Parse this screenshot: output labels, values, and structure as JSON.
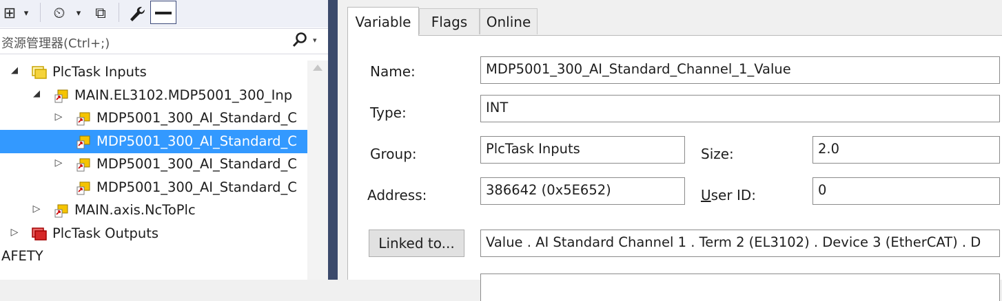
{
  "toolbar": {
    "items": [
      {
        "name": "add-item-icon",
        "glyph": "⊞"
      },
      {
        "name": "dropdown-caret-icon",
        "glyph": "▾"
      },
      {
        "name": "history-icon",
        "glyph": "⏲"
      },
      {
        "name": "dropdown-caret-icon",
        "glyph": "▾"
      },
      {
        "name": "copy-windows-icon",
        "glyph": "⧉"
      },
      {
        "name": "wrench-icon",
        "glyph": "🔧"
      }
    ]
  },
  "search": {
    "placeholder": "资源管理器(Ctrl+;)",
    "icon": "search-icon"
  },
  "tree": {
    "rows": [
      {
        "label": "PlcTask Inputs",
        "indent": 0,
        "twisty": "expanded",
        "icon": "folder-yellow-icon",
        "selected": false
      },
      {
        "label": "MAIN.EL3102.MDP5001_300_Inp",
        "indent": 1,
        "twisty": "expanded",
        "icon": "variable-input-icon",
        "selected": false
      },
      {
        "label": "MDP5001_300_AI_Standard_C",
        "indent": 2,
        "twisty": "collapsed",
        "icon": "variable-input-icon",
        "selected": false
      },
      {
        "label": "MDP5001_300_AI_Standard_C",
        "indent": 2,
        "twisty": "none",
        "icon": "variable-input-icon",
        "selected": true
      },
      {
        "label": "MDP5001_300_AI_Standard_C",
        "indent": 2,
        "twisty": "collapsed",
        "icon": "variable-input-icon",
        "selected": false
      },
      {
        "label": "MDP5001_300_AI_Standard_C",
        "indent": 2,
        "twisty": "none",
        "icon": "variable-input-icon",
        "selected": false
      },
      {
        "label": "MAIN.axis.NcToPlc",
        "indent": 1,
        "twisty": "collapsed",
        "icon": "variable-input-icon",
        "selected": false
      },
      {
        "label": "PlcTask Outputs",
        "indent": 0,
        "twisty": "collapsed",
        "icon": "folder-red-icon",
        "selected": false
      },
      {
        "label": "AFETY",
        "indent": -1,
        "twisty": "none",
        "icon": "",
        "selected": false
      }
    ]
  },
  "tabs": [
    "Variable",
    "Flags",
    "Online"
  ],
  "active_tab": "Variable",
  "form": {
    "name_label": "Name:",
    "name_value": "MDP5001_300_AI_Standard_Channel_1_Value",
    "type_label": "Type:",
    "type_value": "INT",
    "group_label": "Group:",
    "group_value": "PlcTask Inputs",
    "size_label": "Size:",
    "size_value": "2.0",
    "address_label": "Address:",
    "address_value": "386642 (0x5E652)",
    "userid_label_u": "U",
    "userid_label_rest": "ser ID:",
    "userid_value": "0",
    "linked_button": "Linked to...",
    "linked_value": "Value . AI Standard Channel 1 . Term 2 (EL3102) . Device 3 (EtherCAT) . D"
  },
  "colors": {
    "selection": "#3399ff",
    "splitter": "#3b4a6b",
    "folder_yellow": "#f5d33a",
    "folder_red": "#d62828"
  }
}
